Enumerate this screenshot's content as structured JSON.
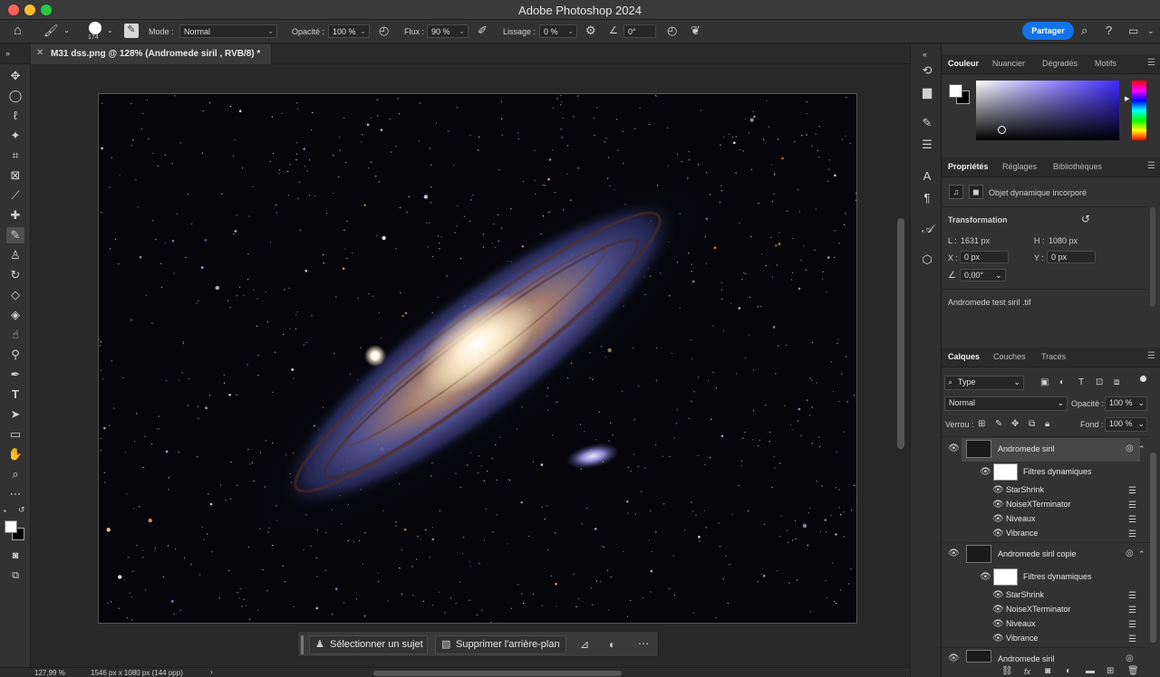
{
  "window": {
    "title": "Adobe Photoshop 2024"
  },
  "options_bar": {
    "brush_size": "174",
    "mode_label": "Mode :",
    "mode_value": "Normal",
    "opacity_label": "Opacité :",
    "opacity_value": "100 %",
    "flow_label": "Flux :",
    "flow_value": "90 %",
    "smoothing_label": "Lissage :",
    "smoothing_value": "0 %",
    "angle_value": "0°",
    "share_label": "Partager"
  },
  "document": {
    "tab_title": "M31 dss.png @ 128% (Andromede siril , RVB/8) *"
  },
  "context_bar": {
    "select_subject": "Sélectionner un sujet",
    "remove_background": "Supprimer l'arrière-plan"
  },
  "status_bar": {
    "zoom": "127,99 %",
    "doc_size": "1546 px x 1080 px (144 ppp)"
  },
  "color_panel": {
    "tabs": [
      "Couleur",
      "Nuancier",
      "Dégradés",
      "Motifs"
    ],
    "colors": {
      "foreground": "#ffffff",
      "background": "#000000",
      "field_hue": "#3d2bff"
    }
  },
  "properties_panel": {
    "tabs": [
      "Propriétés",
      "Réglages",
      "Bibliothèques"
    ],
    "object_type": "Objet dynamique incorporé",
    "transform_heading": "Transformation",
    "width_label": "L :",
    "width_value": "1631 px",
    "height_label": "H :",
    "height_value": "1080 px",
    "x_label": "X :",
    "x_value": "0 px",
    "y_label": "Y :",
    "y_value": "0 px",
    "angle_value": "0,00°",
    "linked_file": "Andromede test siril .tif"
  },
  "layers_panel": {
    "tabs": [
      "Calques",
      "Couches",
      "Tracés"
    ],
    "filter_kind": "Type",
    "blend_mode": "Normal",
    "opacity_label": "Opacité :",
    "opacity_value": "100 %",
    "lock_label": "Verrou :",
    "fill_label": "Fond :",
    "fill_value": "100 %",
    "layers": [
      {
        "name": "Andromede siril",
        "filters_label": "Filtres dynamiques",
        "filters": [
          "StarShrink",
          "NoiseXTerminator",
          "Niveaux",
          "Vibrance"
        ]
      },
      {
        "name": "Andromede siril copie",
        "filters_label": "Filtres dynamiques",
        "filters": [
          "StarShrink",
          "NoiseXTerminator",
          "Niveaux",
          "Vibrance"
        ]
      },
      {
        "name": "Andromede siril"
      }
    ]
  }
}
